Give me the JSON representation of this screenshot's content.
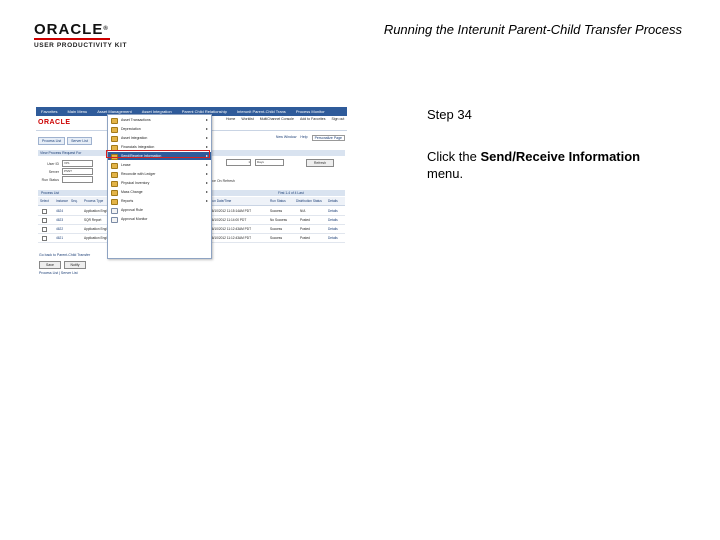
{
  "header": {
    "logo_word": "ORACLE",
    "logo_reg": "®",
    "logo_sub": "USER PRODUCTIVITY KIT",
    "title": "Running the Interunit Parent-Child Transfer Process"
  },
  "step": {
    "number": "Step 34",
    "text_prefix": "Click the ",
    "menu_name": "Send/Receive Information",
    "text_suffix": " menu."
  },
  "colors": {
    "nav": "#2f5b9a",
    "highlight_frame": "#d62020"
  },
  "screenshot": {
    "nav": [
      "Favorites",
      "Main Menu",
      "Asset Management",
      "Asset Integration",
      "Parent Child Relationship",
      "Interunit Parent-Child Trans",
      "Process Monitor"
    ],
    "top_links": [
      "Home",
      "Worklist",
      "MultiChannel Console",
      "Add to Favorites",
      "Sign out"
    ],
    "tabs": [
      "Process List",
      "Server List"
    ],
    "util": [
      "New Window",
      "Help",
      "Personalize Page"
    ],
    "section_title": "View Process Request For",
    "fields": [
      {
        "label": "User ID",
        "value": "VP1"
      },
      {
        "label": "Server",
        "value": "PSNT"
      },
      {
        "label": "Run Status",
        "value": ""
      }
    ],
    "right_fields": [
      "1",
      "Days"
    ],
    "refresh": "Refresh",
    "run_label": "Save On Refresh",
    "grid_title": "Process List",
    "grid_nav": "First  1-4 of 4  Last",
    "columns": [
      "Select",
      "Instance",
      "Seq.",
      "Process Type",
      "Process Name",
      "User",
      "Run Date/Time",
      "Run Status",
      "Distribution Status",
      "Details"
    ],
    "rows": [
      {
        "instance": "4624",
        "type": "Application Engine",
        "name": "AM_PRNT_CHLD",
        "user": "VP1",
        "time": "06/10/2012 11:15:14AM PDT",
        "status": "Success",
        "dist": "N/A",
        "details": "Details"
      },
      {
        "instance": "4623",
        "type": "SQR Report",
        "name": "AMPFRGN",
        "user": "VP1",
        "time": "06/10/2012 11:14:00 PDT",
        "status": "No Success",
        "dist": "Posted",
        "details": "Details"
      },
      {
        "instance": "4622",
        "type": "Application Engine",
        "name": "FS_STREAMLN",
        "user": "VP1",
        "time": "06/10/2012 11:12:43AM PDT",
        "status": "Success",
        "dist": "Posted",
        "details": "Details"
      },
      {
        "instance": "4621",
        "type": "Application Engine",
        "name": "FS_PDSTORE_REP",
        "user": "VP1",
        "time": "06/10/2012 11:12:43AM PDT",
        "status": "Success",
        "dist": "Posted",
        "details": "Details"
      }
    ],
    "bottom_link": "Go back to Parent-Child Transfer",
    "buttons": [
      "Save",
      "Notify"
    ],
    "foot_link": "Process List | Server List",
    "menu": [
      {
        "label": "Asset Transactions",
        "icon": "folder-icon",
        "arrow": "▸"
      },
      {
        "label": "Depreciation",
        "icon": "folder-icon",
        "arrow": "▸"
      },
      {
        "label": "Asset Integration",
        "icon": "folder-icon",
        "arrow": "▸"
      },
      {
        "label": "Financials Integration",
        "icon": "folder-icon",
        "arrow": "▸"
      },
      {
        "label": "Send/Receive Information",
        "icon": "folder-icon",
        "arrow": "▸"
      },
      {
        "label": "Lease",
        "icon": "folder-icon",
        "arrow": "▸"
      },
      {
        "label": "Reconcile with Ledger",
        "icon": "folder-icon",
        "arrow": "▸"
      },
      {
        "label": "Physical Inventory",
        "icon": "folder-icon",
        "arrow": "▸"
      },
      {
        "label": "Mass Change",
        "icon": "folder-icon",
        "arrow": "▸"
      },
      {
        "label": "Reports",
        "icon": "folder-icon",
        "arrow": "▸"
      },
      {
        "label": "Approval Rule",
        "icon": "doc-icon",
        "arrow": ""
      },
      {
        "label": "Approval Monitor",
        "icon": "doc-icon",
        "arrow": ""
      }
    ]
  }
}
